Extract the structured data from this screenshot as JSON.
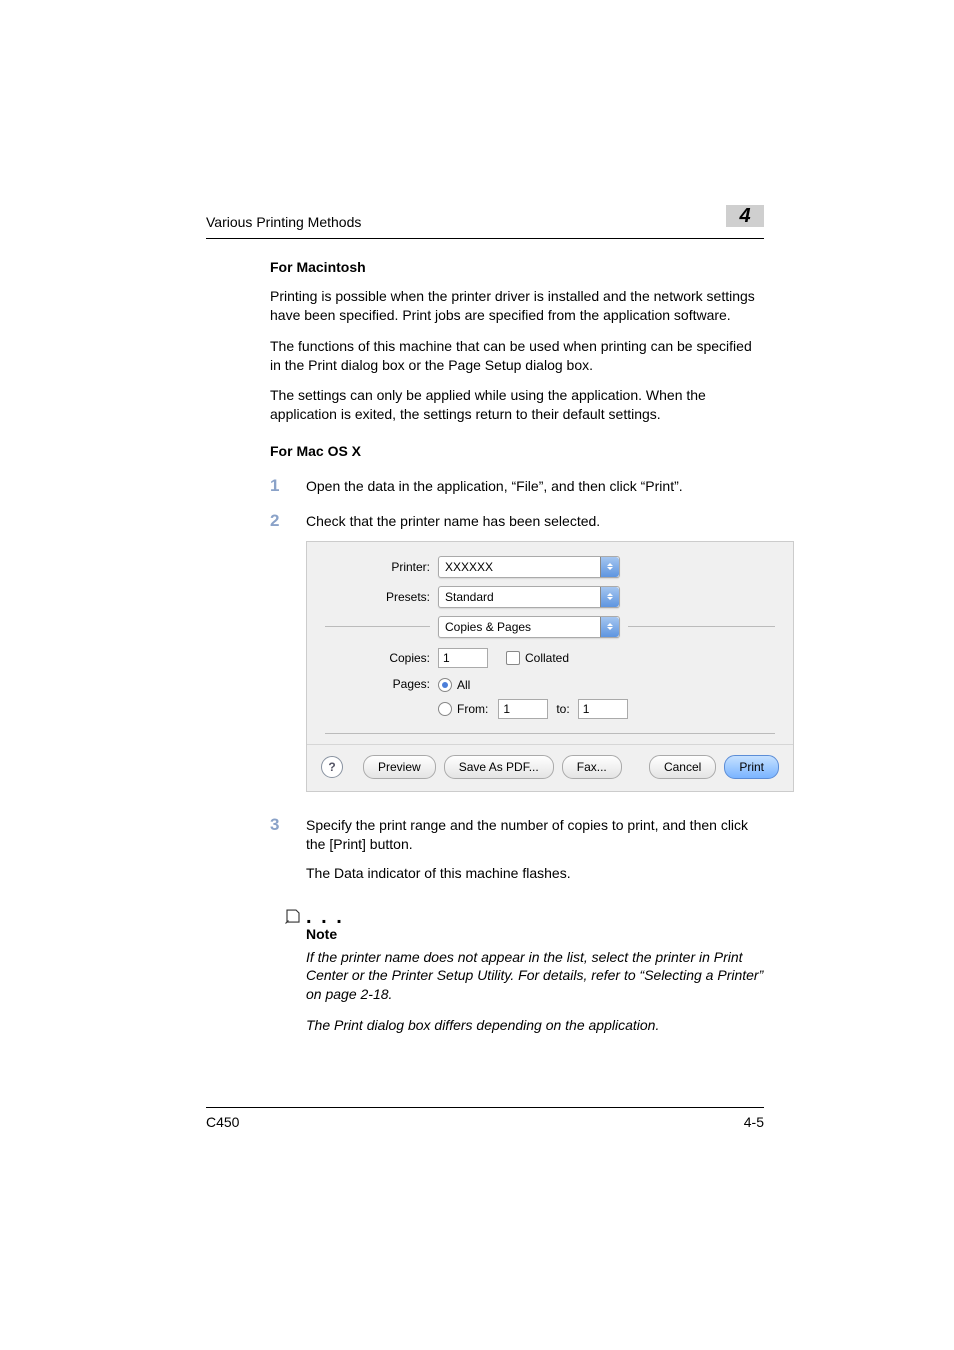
{
  "header": {
    "section_title": "Various Printing Methods",
    "chapter_number": "4"
  },
  "h3_mac": "For Macintosh",
  "p1": "Printing is possible when the printer driver is installed and the network settings have been specified. Print jobs are specified from the application software.",
  "p2": "The functions of this machine that can be used when printing can be specified in the Print dialog box or the Page Setup dialog box.",
  "p3": "The settings can only be applied while using the application. When the application is exited, the settings return to their default settings.",
  "h3_osx": "For Mac OS X",
  "steps": {
    "s1": {
      "num": "1",
      "text": "Open the data in the application, “File”, and then click “Print”."
    },
    "s2": {
      "num": "2",
      "text": "Check that the printer name has been selected."
    },
    "s3": {
      "num": "3",
      "text1": "Specify the print range and the number of copies to print, and then click the [Print] button.",
      "text2": "The Data indicator of this machine flashes."
    }
  },
  "dialog": {
    "printer_label": "Printer:",
    "printer_value": "XXXXXX",
    "presets_label": "Presets:",
    "presets_value": "Standard",
    "section_value": "Copies & Pages",
    "copies_label": "Copies:",
    "copies_value": "1",
    "collated_label": "Collated",
    "pages_label": "Pages:",
    "radio_all": "All",
    "radio_from": "From:",
    "from_value": "1",
    "to_label": "to:",
    "to_value": "1",
    "help": "?",
    "btn_preview": "Preview",
    "btn_savepdf": "Save As PDF...",
    "btn_fax": "Fax...",
    "btn_cancel": "Cancel",
    "btn_print": "Print"
  },
  "note": {
    "dots": ". . .",
    "title": "Note",
    "text1": "If the printer name does not appear in the list, select the printer in Print Center or the Printer Setup Utility. For details, refer to “Selecting a Printer” on page 2-18.",
    "text2": "The Print dialog box differs depending on the application."
  },
  "footer": {
    "model": "C450",
    "page": "4-5"
  }
}
